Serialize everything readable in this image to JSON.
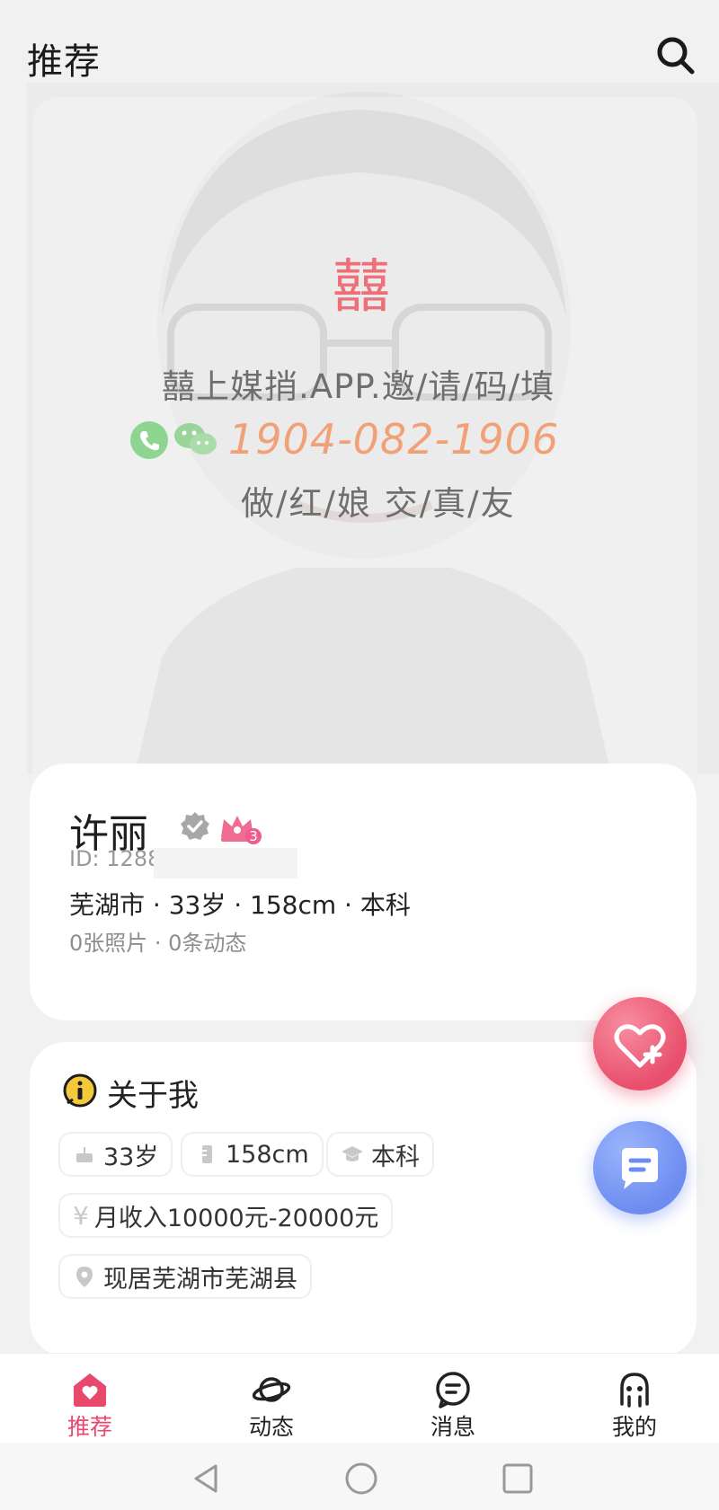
{
  "header": {
    "title": "推荐",
    "search_icon": "search-icon"
  },
  "photo": {
    "watermark_symbol": "囍",
    "watermark_line1": "囍上媒捎.APP.邀/请/码/填",
    "watermark_phone": "1904-082-1906",
    "watermark_line3": "做/红/娘 交/真/友"
  },
  "profile": {
    "name": "许丽",
    "vip_level": "3",
    "id_label": "ID: 1288",
    "basic_info": "芜湖市 · 33岁 · 158cm · 本科",
    "stats": "0张照片 · 0条动态"
  },
  "about": {
    "title": "关于我",
    "tags": {
      "age": "33岁",
      "height": "158cm",
      "education": "本科",
      "income": "月收入10000元-20000元",
      "residence": "现居芜湖市芜湖县"
    }
  },
  "nav": {
    "items": [
      {
        "label": "推荐",
        "icon": "home-heart-icon"
      },
      {
        "label": "动态",
        "icon": "planet-icon"
      },
      {
        "label": "消息",
        "icon": "message-icon"
      },
      {
        "label": "我的",
        "icon": "profile-icon"
      }
    ]
  },
  "colors": {
    "accent": "#e8486b",
    "like": "#e84f6c",
    "message": "#6d8cf0"
  }
}
